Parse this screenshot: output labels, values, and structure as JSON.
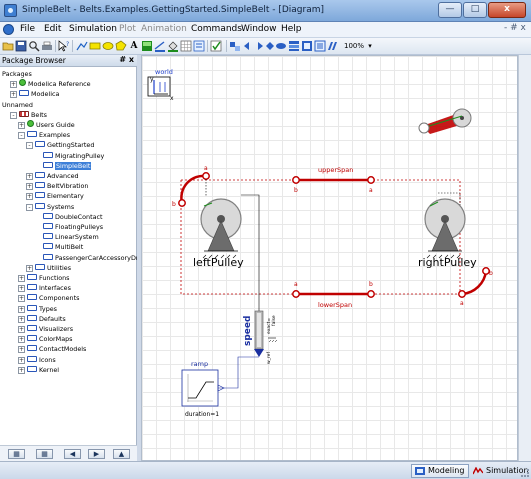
{
  "window": {
    "title": "SimpleBelt - Belts.Examples.GettingStarted.SimpleBelt - [Diagram]",
    "minimize_glyph": "—",
    "maximize_glyph": "□",
    "close_glyph": "x"
  },
  "menu": {
    "items": [
      "File",
      "Edit",
      "Simulation",
      "Plot",
      "Animation",
      "Commands",
      "Window",
      "Help"
    ],
    "disabled": [
      "Plot",
      "Animation"
    ],
    "mdi_controls": "- # x"
  },
  "toolbar": {
    "zoom": "100%",
    "text_tool": "A",
    "colors": {
      "line": "#e8d400",
      "fill": "#1d8c1d",
      "text": "#2a5fc4"
    }
  },
  "package_browser": {
    "title": "Package Browser",
    "header_buttons": "# x",
    "tree": [
      {
        "label": "Packages",
        "level": 0,
        "expander": "",
        "icon": "none"
      },
      {
        "label": "Modelica Reference",
        "level": 1,
        "expander": "+",
        "icon": "green"
      },
      {
        "label": "Modelica",
        "level": 1,
        "expander": "+",
        "icon": "package"
      },
      {
        "label": "Unnamed",
        "level": 0,
        "expander": "",
        "icon": "none"
      },
      {
        "label": "Belts",
        "level": 1,
        "expander": "-",
        "icon": "belts"
      },
      {
        "label": "Users Guide",
        "level": 2,
        "expander": "+",
        "icon": "green"
      },
      {
        "label": "Examples",
        "level": 2,
        "expander": "-",
        "icon": "package"
      },
      {
        "label": "GettingStarted",
        "level": 3,
        "expander": "-",
        "icon": "package"
      },
      {
        "label": "MigratingPulley",
        "level": 4,
        "expander": "",
        "icon": "package"
      },
      {
        "label": "SimpleBelt",
        "level": 4,
        "expander": "",
        "icon": "package",
        "selected": true
      },
      {
        "label": "Advanced",
        "level": 3,
        "expander": "+",
        "icon": "package"
      },
      {
        "label": "BeltVibration",
        "level": 3,
        "expander": "+",
        "icon": "package"
      },
      {
        "label": "Elementary",
        "level": 3,
        "expander": "+",
        "icon": "package"
      },
      {
        "label": "Systems",
        "level": 3,
        "expander": "-",
        "icon": "package"
      },
      {
        "label": "DoubleContact",
        "level": 4,
        "expander": "",
        "icon": "package"
      },
      {
        "label": "FloatingPulleys",
        "level": 4,
        "expander": "",
        "icon": "package"
      },
      {
        "label": "LinearSystem",
        "level": 4,
        "expander": "",
        "icon": "package"
      },
      {
        "label": "MultiBelt",
        "level": 4,
        "expander": "",
        "icon": "package"
      },
      {
        "label": "PassengerCarAccessoryDrive",
        "level": 4,
        "expander": "",
        "icon": "package"
      },
      {
        "label": "Utilities",
        "level": 3,
        "expander": "+",
        "icon": "package"
      },
      {
        "label": "Functions",
        "level": 2,
        "expander": "+",
        "icon": "package"
      },
      {
        "label": "Interfaces",
        "level": 2,
        "expander": "+",
        "icon": "package"
      },
      {
        "label": "Components",
        "level": 2,
        "expander": "+",
        "icon": "package"
      },
      {
        "label": "Types",
        "level": 2,
        "expander": "+",
        "icon": "package"
      },
      {
        "label": "Defaults",
        "level": 2,
        "expander": "+",
        "icon": "package"
      },
      {
        "label": "Visualizers",
        "level": 2,
        "expander": "+",
        "icon": "package"
      },
      {
        "label": "ColorMaps",
        "level": 2,
        "expander": "+",
        "icon": "package"
      },
      {
        "label": "ContactModels",
        "level": 2,
        "expander": "+",
        "icon": "package"
      },
      {
        "label": "Icons",
        "level": 2,
        "expander": "+",
        "icon": "package"
      },
      {
        "label": "Kernel",
        "level": 2,
        "expander": "+",
        "icon": "package"
      }
    ],
    "footer_buttons": [
      "grid-icon",
      "tree-icon",
      "back-icon",
      "forward-icon",
      "up-icon"
    ],
    "footer_glyphs": [
      "▦",
      "▦",
      "◀",
      "▶",
      "▲"
    ]
  },
  "diagram": {
    "world_label": "world",
    "world_x": "x",
    "world_y": "y",
    "left_pulley": "leftPulley",
    "right_pulley": "rightPulley",
    "upper_span": "upperSpan",
    "lower_span": "lowerSpan",
    "port_a": "a",
    "port_b": "b",
    "speed_label": "speed",
    "speed_params": "exact=",
    "speed_false": "false",
    "w_ref": "w_ref",
    "ramp_label": "ramp",
    "ramp_param": "duration=1",
    "belt_color": "#c00000",
    "pulley_color": "#d9d9d9"
  },
  "statusbar": {
    "modeling": "Modeling",
    "simulation": "Simulation"
  }
}
